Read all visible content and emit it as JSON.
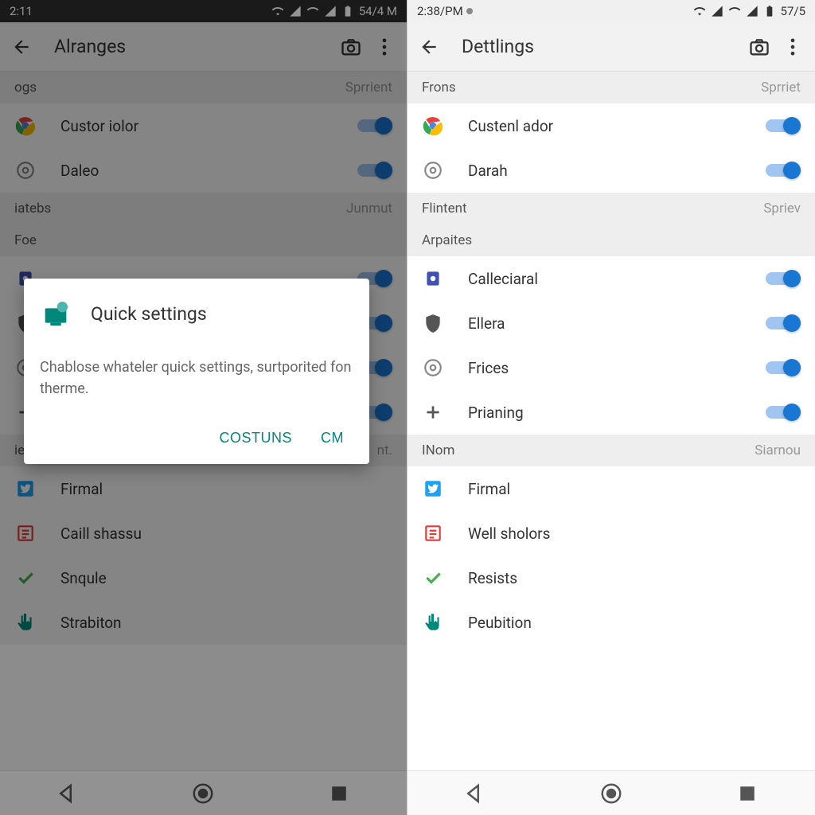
{
  "left": {
    "status": {
      "time": "2:11",
      "battery": "54/4 M"
    },
    "appbar": {
      "title": "Alranges"
    },
    "sections": [
      {
        "header": "ogs",
        "sub": "Sprrient",
        "items": [
          {
            "icon": "chrome",
            "label": "Custor iolor",
            "toggle": true
          },
          {
            "icon": "circle",
            "label": "Daleo",
            "toggle": true
          }
        ]
      },
      {
        "header": "iatebs",
        "sub": "Junmut",
        "items": []
      },
      {
        "header": "Foe",
        "sub": "",
        "items": [
          {
            "icon": "box",
            "label": "",
            "toggle": true
          },
          {
            "icon": "shield",
            "label": "",
            "toggle": true
          },
          {
            "icon": "circle",
            "label": "",
            "toggle": true
          },
          {
            "icon": "plus",
            "label": "",
            "toggle": true
          }
        ]
      },
      {
        "header": "ie",
        "sub": "nt.",
        "items": [
          {
            "icon": "twitter",
            "label": "Firmal"
          },
          {
            "icon": "list",
            "label": "Caill shassu"
          },
          {
            "icon": "check",
            "label": "Snqule"
          },
          {
            "icon": "hand",
            "label": "Strabiton"
          }
        ]
      }
    ],
    "dialog": {
      "title": "Quick settings",
      "body": "Chablose whateler quick settings, surtporited fon therme.",
      "actions": [
        "COSTUNS",
        "CM"
      ]
    }
  },
  "right": {
    "status": {
      "time": "2:38/PM",
      "battery": "57/5"
    },
    "appbar": {
      "title": "Dettlings"
    },
    "sections": [
      {
        "header": "Frons",
        "sub": "Sprriet",
        "items": [
          {
            "icon": "chrome",
            "label": "Custenl ador",
            "toggle": true
          },
          {
            "icon": "circle",
            "label": "Darah",
            "toggle": true
          }
        ]
      },
      {
        "header": "Flintent",
        "sub": "Spriev",
        "items": []
      },
      {
        "header": "Arpaites",
        "sub": "",
        "items": [
          {
            "icon": "box",
            "label": "Calleciaral",
            "toggle": true
          },
          {
            "icon": "shield",
            "label": "Ellera",
            "toggle": true
          },
          {
            "icon": "circle",
            "label": "Frices",
            "toggle": true
          },
          {
            "icon": "plus",
            "label": "Prianing",
            "toggle": true
          }
        ]
      },
      {
        "header": "INom",
        "sub": "Siarnou",
        "items": [
          {
            "icon": "twitter",
            "label": "Firmal"
          },
          {
            "icon": "list",
            "label": "Well sholors"
          },
          {
            "icon": "check",
            "label": "Resists"
          },
          {
            "icon": "hand",
            "label": "Peubition"
          }
        ]
      }
    ]
  }
}
